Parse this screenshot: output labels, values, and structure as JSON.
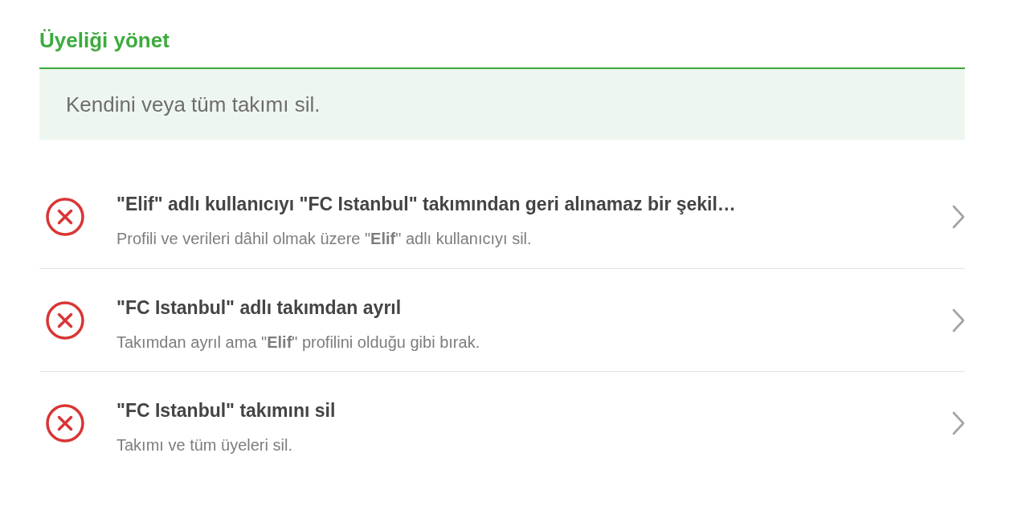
{
  "title": "Üyeliği yönet",
  "info": "Kendini veya tüm takımı sil.",
  "actions": [
    {
      "title": "\"Elif\" adlı kullanıcıyı \"FC Istanbul\" takımından geri alınamaz bir şekil…",
      "description": "Profili ve verileri dâhil olmak üzere \"**Elif**\" adlı kullanıcıyı sil."
    },
    {
      "title": "\"FC Istanbul\" adlı takımdan ayrıl",
      "description": "Takımdan ayrıl ama \"**Elif**\" profilini olduğu gibi bırak."
    },
    {
      "title": "\"FC Istanbul\" takımını sil",
      "description": "Takımı ve tüm üyeleri sil."
    }
  ]
}
